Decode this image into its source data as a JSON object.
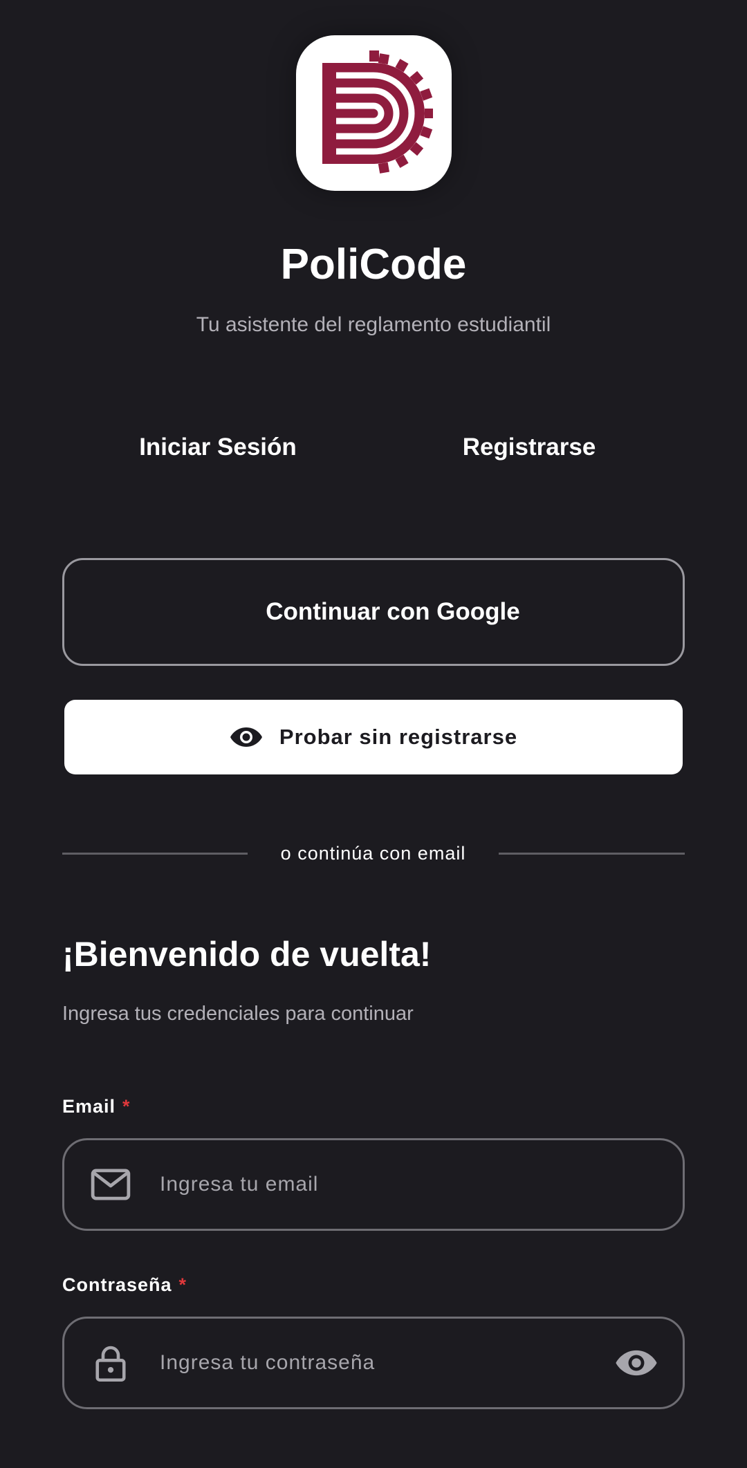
{
  "app": {
    "title": "PoliCode",
    "subtitle": "Tu asistente del reglamento estudiantil",
    "brand_color": "#8f1c3e"
  },
  "tabs": [
    {
      "label": "Iniciar Sesión",
      "selected": true
    },
    {
      "label": "Registrarse",
      "selected": false
    }
  ],
  "auth": {
    "google_label": "Continuar con Google",
    "guest_label": "Probar sin registrarse",
    "guest_icon": "eye-icon",
    "divider_text": "o continúa con email"
  },
  "welcome": {
    "title": "¡Bienvenido de vuelta!",
    "subtitle": "Ingresa tus credenciales para continuar"
  },
  "form": {
    "email": {
      "label": "Email",
      "required_mark": "*",
      "placeholder": "Ingresa tu email",
      "value": "",
      "icon": "mail-icon"
    },
    "password": {
      "label": "Contraseña",
      "required_mark": "*",
      "placeholder": "Ingresa tu contraseña",
      "value": "",
      "icon": "lock-icon",
      "toggle_icon": "eye-icon"
    }
  },
  "colors": {
    "background": "#1c1b20",
    "required": "#e0383b"
  }
}
